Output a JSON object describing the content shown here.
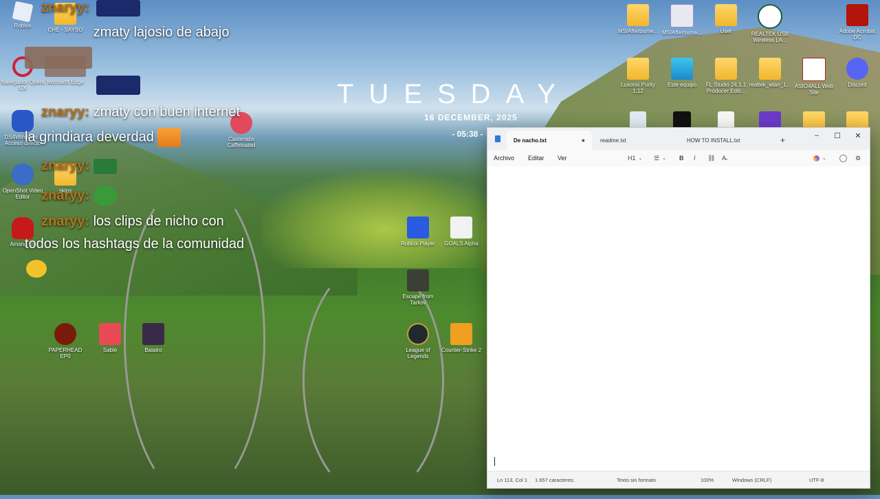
{
  "desktop": {
    "left_icons": [
      {
        "label": "Roblox",
        "icon": "roblox-icon"
      },
      {
        "label": "CHE - SAYSO",
        "icon": "folder-icon"
      },
      {
        "label": "Navegador Opera GX",
        "icon": "opera-gx-icon"
      },
      {
        "label": "Microsoft Edge",
        "icon": "edge-icon"
      },
      {
        "label": "DS4Windows - Acceso directo",
        "icon": "ds4windows-icon"
      },
      {
        "label": "OpenShot Video Editor",
        "icon": "openshot-icon"
      },
      {
        "label": "skips",
        "icon": "folder-icon"
      },
      {
        "label": "Among Us",
        "icon": "among-us-icon"
      },
      {
        "label": "Casterlabs Caffeinated",
        "icon": "casterlabs-icon"
      },
      {
        "label": "PAPERHEAD EP0",
        "icon": "paperhead-icon"
      },
      {
        "label": "Sable",
        "icon": "sable-icon"
      },
      {
        "label": "Balatro",
        "icon": "balatro-icon"
      },
      {
        "label": "Roblox Player",
        "icon": "roblox-player-icon"
      },
      {
        "label": "GOALS Alpha",
        "icon": "goals-icon"
      },
      {
        "label": "Escape from Tarkov",
        "icon": "tarkov-icon"
      },
      {
        "label": "League of Legends",
        "icon": "league-icon"
      },
      {
        "label": "Counter-Strike 2",
        "icon": "cs2-icon"
      }
    ],
    "right_icons": [
      {
        "label": "MSIAfterburne...",
        "icon": "folder-icon"
      },
      {
        "label": "MSIAfterburne...",
        "icon": "installer-icon"
      },
      {
        "label": "User",
        "icon": "folder-icon"
      },
      {
        "label": "REALTEK USB Wireless LA...",
        "icon": "realtek-icon"
      },
      {
        "label": "Adobe Acrobat DC",
        "icon": "acrobat-icon"
      },
      {
        "label": "Luxonix Purity 1.12",
        "icon": "folder-icon"
      },
      {
        "label": "Este equipo",
        "icon": "computer-icon"
      },
      {
        "label": "FL Studio 24.1.1 Producer Editi...",
        "icon": "folder-icon"
      },
      {
        "label": "realtek_wlan_1...",
        "icon": "folder-icon"
      },
      {
        "label": "ASIO4ALL Web Site",
        "icon": "asio-icon"
      },
      {
        "label": "Discord",
        "icon": "discord-icon"
      }
    ]
  },
  "clock": {
    "day": "TUESDAY",
    "date": "16 DECEMBER, 2025",
    "time": "- 05:38 -"
  },
  "chat": [
    {
      "user": "znaryy:",
      "message": "zmaty lajosio de abajo"
    },
    {
      "user": "znaryy:",
      "message": "zmaty con buen internet"
    },
    {
      "user": "",
      "message": "la grindiara deverdad"
    },
    {
      "user": "znaryy:",
      "message": ""
    },
    {
      "user": "znaryy:",
      "message": ""
    },
    {
      "user": "znaryy:",
      "message": "los clips de nicho con"
    },
    {
      "user": "",
      "message": "todos los hashtags de la comunidad"
    }
  ],
  "notepad": {
    "tabs": [
      {
        "label": "De nacho.txt",
        "active": true
      },
      {
        "label": "readme.txt",
        "active": false
      },
      {
        "label": "HOW TO INSTALL.txt",
        "active": false
      }
    ],
    "new_tab": "+",
    "window_buttons": {
      "minimize": "–",
      "maximize": "☐",
      "close": "✕"
    },
    "menu": {
      "file": "Archivo",
      "edit": "Editar",
      "view": "Ver"
    },
    "toolbar": {
      "heading": "H1",
      "bold": "B",
      "italic": "I"
    },
    "status": {
      "position": "Ln 113, Col 1",
      "chars": "1.657 caracteres.",
      "format": "Texto sin formato",
      "zoom": "100%",
      "line_ending": "Windows (CRLF)",
      "encoding": "UTF-8"
    }
  }
}
